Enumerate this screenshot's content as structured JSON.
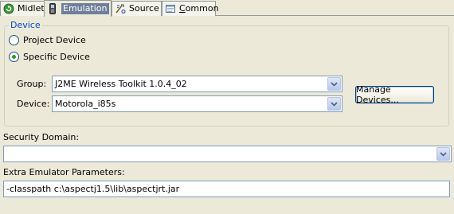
{
  "tabs": [
    {
      "label": "Midlet",
      "mnemonic": "",
      "icon": "run-icon"
    },
    {
      "label": "Emulation",
      "mnemonic": "",
      "icon": "phone-icon",
      "active": true
    },
    {
      "label": "Source",
      "mnemonic": "",
      "icon": "source-icon"
    },
    {
      "label_pre": "",
      "mnemonic": "C",
      "label_post": "ommon",
      "icon": "common-icon"
    }
  ],
  "device_group": {
    "legend": "Device",
    "project_device": "Project Device",
    "specific_device": "Specific Device",
    "selected": "specific_device",
    "group_label": "Group:",
    "group_value": "J2ME Wireless Toolkit 1.0.4_02",
    "device_label": "Device:",
    "device_value": "Motorola_i85s",
    "manage_button": "Manage Devices..."
  },
  "security_domain": {
    "label": "Security Domain:",
    "value": ""
  },
  "emulator_params": {
    "label": "Extra Emulator Parameters:",
    "value": "-classpath c:\\aspectj1.5\\lib\\aspectjrt.jar"
  },
  "colors": {
    "background": "#ece9d8",
    "legend": "#0046d5",
    "field_border": "#7f9db9",
    "radio_dot": "#21a121"
  }
}
